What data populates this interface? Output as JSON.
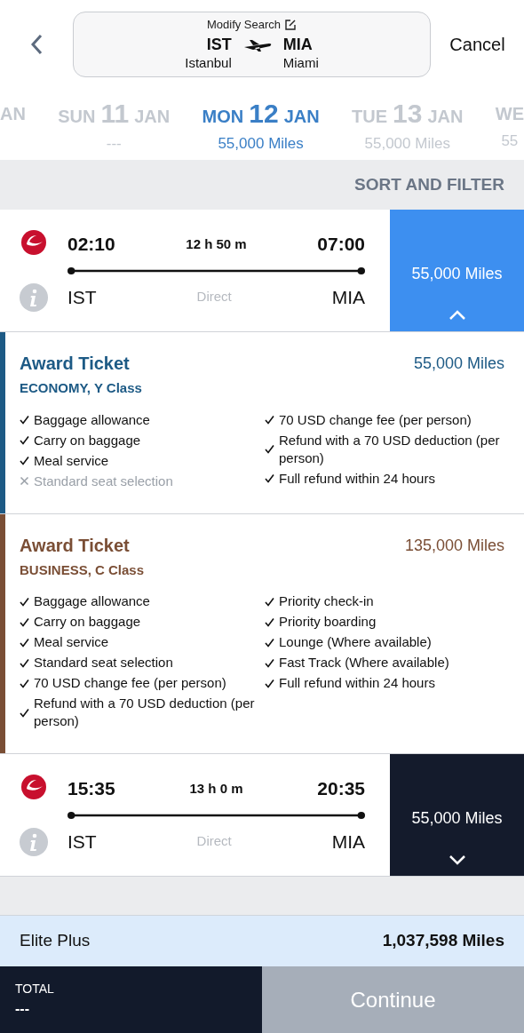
{
  "header": {
    "modify_label": "Modify Search",
    "origin_code": "IST",
    "origin_city": "Istanbul",
    "destination_code": "MIA",
    "destination_city": "Miami",
    "cancel": "Cancel"
  },
  "dates": [
    {
      "month": "AN",
      "selected": false
    },
    {
      "day": "SUN",
      "number": "11",
      "month": "JAN",
      "price": "---",
      "selected": false
    },
    {
      "day": "MON",
      "number": "12",
      "month": "JAN",
      "price": "55,000 Miles",
      "selected": true
    },
    {
      "day": "TUE",
      "number": "13",
      "month": "JAN",
      "price": "55,000 Miles",
      "selected": false
    },
    {
      "day": "WE",
      "price": "55",
      "selected": false
    }
  ],
  "sort_filter": "SORT AND FILTER",
  "flights": [
    {
      "depart": "02:10",
      "duration": "12 h 50 m",
      "arrive": "07:00",
      "from": "IST",
      "stops": "Direct",
      "to": "MIA",
      "price": "55,000 Miles",
      "expanded": true,
      "fares": [
        {
          "title": "Award Ticket",
          "cabin": "ECONOMY, Y Class",
          "price": "55,000 Miles",
          "color": "#1d5a85",
          "left": [
            {
              "text": "Baggage allowance",
              "included": true
            },
            {
              "text": "Carry on baggage",
              "included": true
            },
            {
              "text": "Meal service",
              "included": true
            },
            {
              "text": "Standard seat selection",
              "included": false
            }
          ],
          "right": [
            {
              "text": "70 USD change fee (per person)",
              "included": true
            },
            {
              "text": "Refund with a 70 USD deduction (per person)",
              "included": true
            },
            {
              "text": "Full refund within 24 hours",
              "included": true
            }
          ]
        },
        {
          "title": "Award Ticket",
          "cabin": "BUSINESS, C Class",
          "price": "135,000 Miles",
          "color": "#7a4e35",
          "left": [
            {
              "text": "Baggage allowance",
              "included": true
            },
            {
              "text": "Carry on baggage",
              "included": true
            },
            {
              "text": "Meal service",
              "included": true
            },
            {
              "text": "Standard seat selection",
              "included": true
            },
            {
              "text": "70 USD change fee (per person)",
              "included": true
            },
            {
              "text": "Refund with a 70 USD deduction (per person)",
              "included": true
            }
          ],
          "right": [
            {
              "text": "Priority check-in",
              "included": true
            },
            {
              "text": "Priority boarding",
              "included": true
            },
            {
              "text": "Lounge (Where available)",
              "included": true
            },
            {
              "text": "Fast Track (Where available)",
              "included": true
            },
            {
              "text": "Full refund within 24 hours",
              "included": true
            }
          ]
        }
      ]
    },
    {
      "depart": "15:35",
      "duration": "13 h 0 m",
      "arrive": "20:35",
      "from": "IST",
      "stops": "Direct",
      "to": "MIA",
      "price": "55,000 Miles",
      "expanded": false
    }
  ],
  "member": {
    "tier": "Elite Plus",
    "miles": "1,037,598 Miles"
  },
  "footer": {
    "total_label": "TOTAL",
    "total_value": "---",
    "continue": "Continue",
    "disabled": true
  }
}
